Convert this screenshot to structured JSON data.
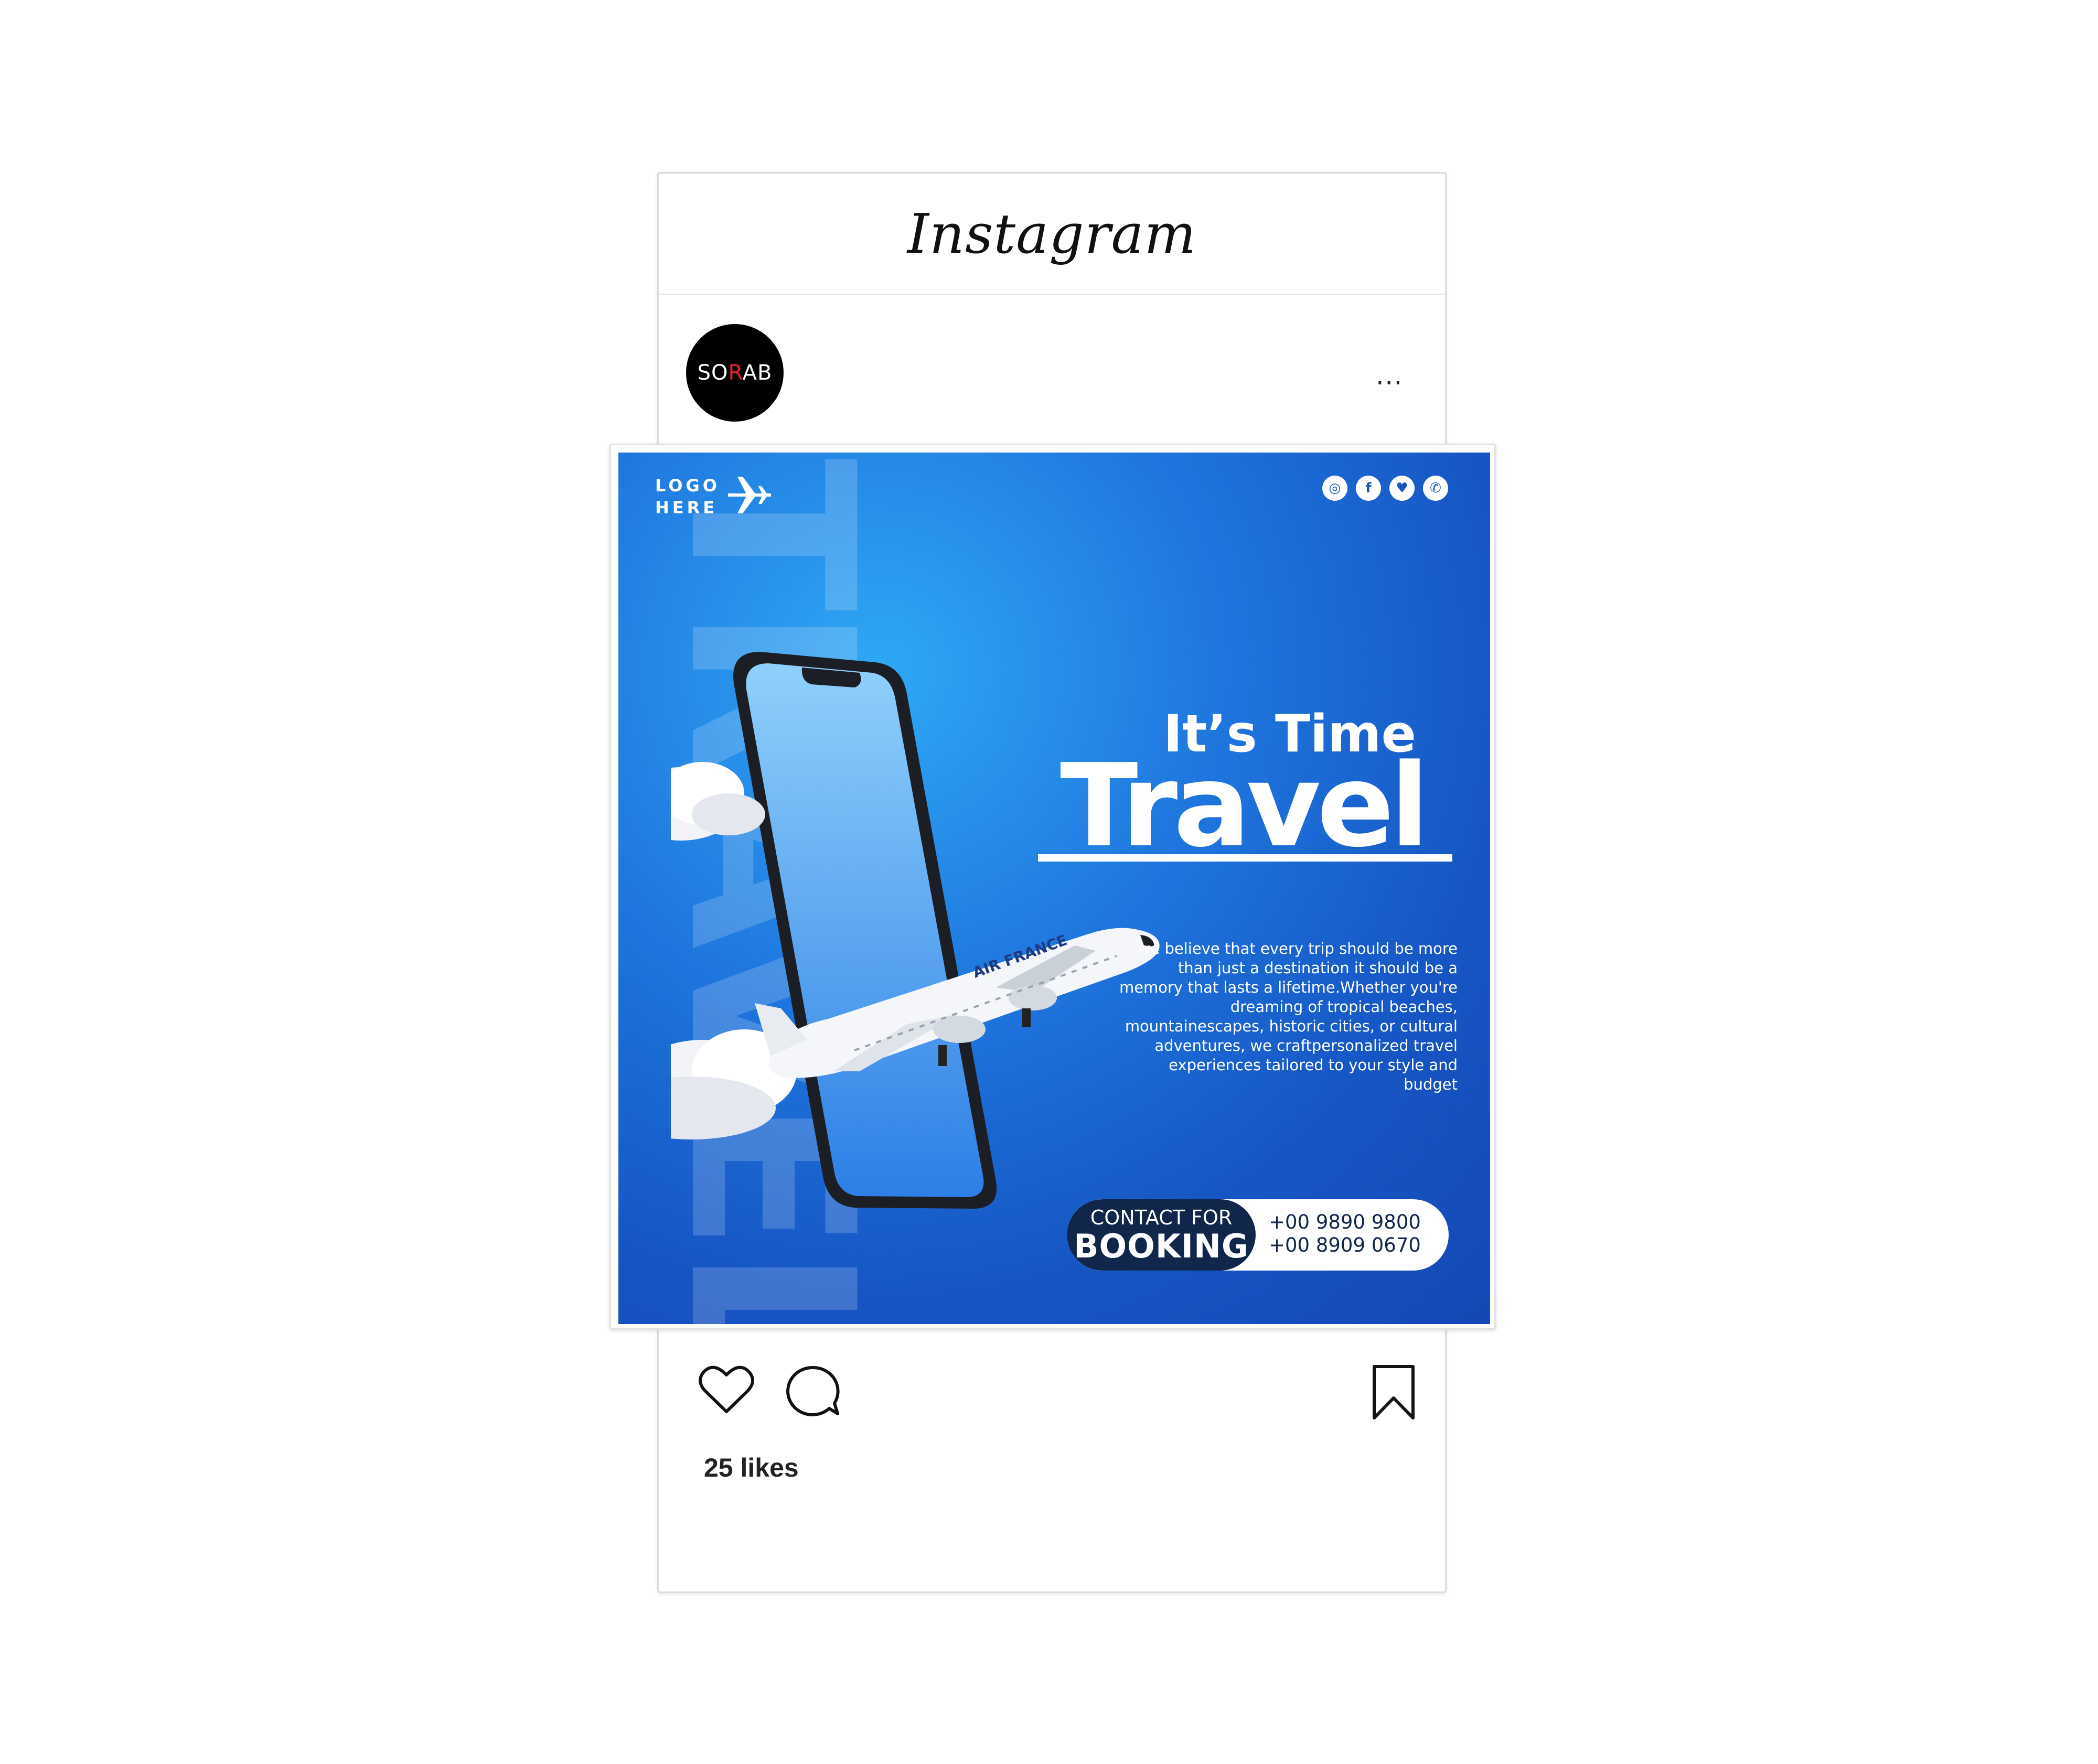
{
  "app": {
    "wordmark": "Instagram"
  },
  "profile": {
    "avatar_text_pre": "SO",
    "avatar_text_accent": "R",
    "avatar_text_post": "AB",
    "more_label": "..."
  },
  "post": {
    "logo_line1": "LOGO",
    "logo_line2": "HERE",
    "watermark_word": "TRAVEL",
    "airline_text": "AIR FRANCE",
    "headline_small": "It’s Time",
    "headline_big": "Travel",
    "body_text": "we believe that every trip should be more than just a destination it should be a memory that lasts a lifetime.Whether you're dreaming of tropical beaches, mountainescapes, historic cities, or cultural adventures, we craftpersonalized travel experiences tailored to your style and budget",
    "booking_small": "CONTACT FOR",
    "booking_big": "BOOKING",
    "phone_1": "+00 9890 9800",
    "phone_2": "+00 8909 0670",
    "social": [
      "instagram-icon",
      "facebook-icon",
      "twitter-icon",
      "whatsapp-icon"
    ]
  },
  "actions": {
    "likes_text": "25 likes"
  },
  "colors": {
    "brand_blue": "#1656c4",
    "navy": "#10264a",
    "accent_red": "#e0242c"
  }
}
